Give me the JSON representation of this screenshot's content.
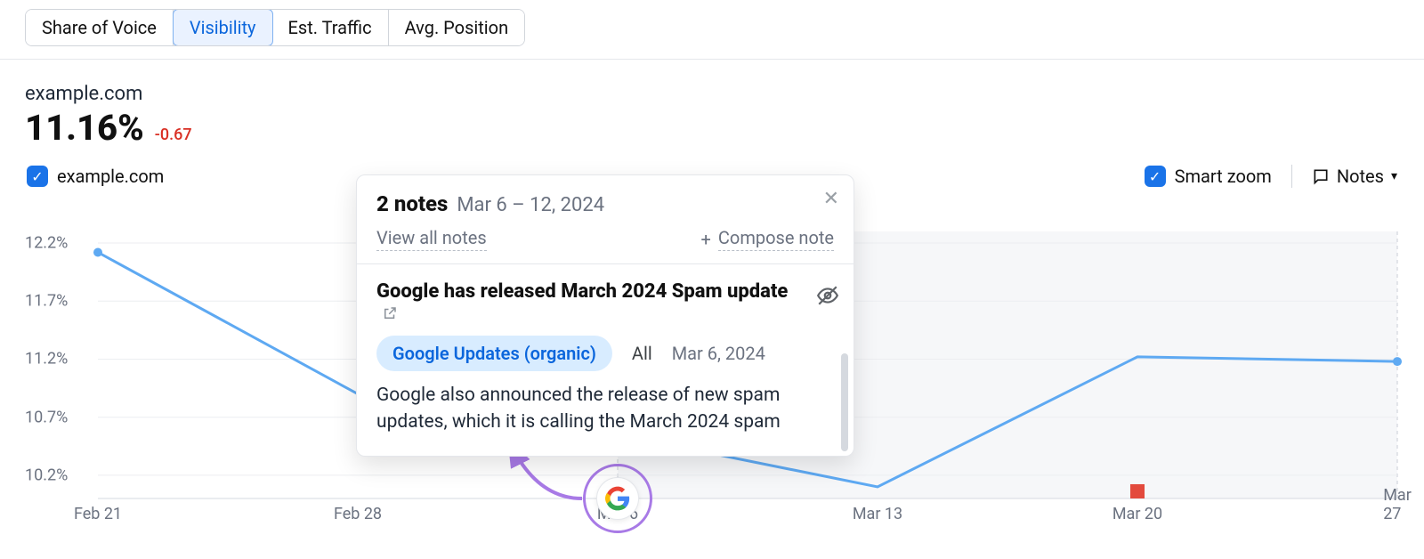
{
  "tabs": {
    "share_of_voice": "Share of Voice",
    "visibility": "Visibility",
    "est_traffic": "Est. Traffic",
    "avg_position": "Avg. Position",
    "active_index": 1
  },
  "domain": "example.com",
  "metric": {
    "value": "11.16%",
    "delta": "-0.67"
  },
  "legend": {
    "series0": "example.com",
    "smart_zoom": "Smart zoom",
    "notes_label": "Notes"
  },
  "note_popover": {
    "count_label": "2 notes",
    "date_range": "Mar 6 – 12, 2024",
    "view_all": "View all notes",
    "compose": "Compose note",
    "title": "Google has released March 2024 Spam update",
    "tag": "Google Updates (organic)",
    "scope": "All",
    "date": "Mar 6, 2024",
    "body": "Google also announced the release of new spam updates, which it is calling the March 2024 spam"
  },
  "colors": {
    "series": "#5ea9f2",
    "delta_neg": "#d93025",
    "accent": "#1a73e8",
    "annotation_ring": "#a87ae6",
    "flag": "#e34a3d"
  },
  "chart_data": {
    "type": "line",
    "title": "",
    "xlabel": "",
    "ylabel": "",
    "ylim": [
      10.0,
      12.3
    ],
    "y_ticks": [
      "12.2%",
      "11.7%",
      "11.2%",
      "10.7%",
      "10.2%"
    ],
    "x_categories": [
      "Feb 21",
      "Feb 28",
      "Mar 6",
      "Mar 13",
      "Mar 20",
      "Mar 27"
    ],
    "shaded_range": [
      "Mar 6",
      "Mar 27"
    ],
    "series": [
      {
        "name": "example.com",
        "x": [
          "Feb 21",
          "Feb 28",
          "Mar 6",
          "Mar 13",
          "Mar 20",
          "Mar 27"
        ],
        "y": [
          12.12,
          10.9,
          10.55,
          10.1,
          11.22,
          11.18
        ]
      }
    ],
    "annotations": [
      {
        "x": "Mar 6",
        "kind": "google-update"
      },
      {
        "x": "Mar 20",
        "kind": "user-flag"
      }
    ]
  }
}
